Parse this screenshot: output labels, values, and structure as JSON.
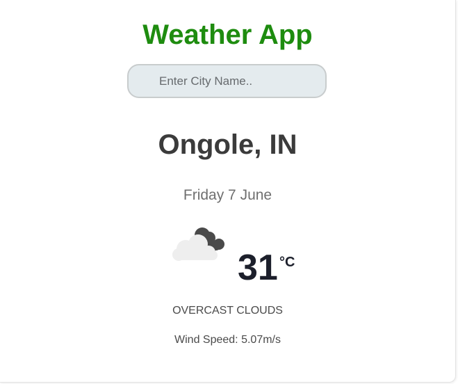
{
  "app": {
    "title": "Weather App",
    "title_color": "#1e8c0f"
  },
  "search": {
    "placeholder": "Enter City Name..",
    "value": ""
  },
  "weather": {
    "location": "Ongole, IN",
    "date": "Friday 7 June",
    "icon": "cloudy-icon",
    "temperature": "31",
    "unit": "°C",
    "description": "OVERCAST CLOUDS",
    "wind_speed": "Wind Speed: 5.07m/s"
  }
}
